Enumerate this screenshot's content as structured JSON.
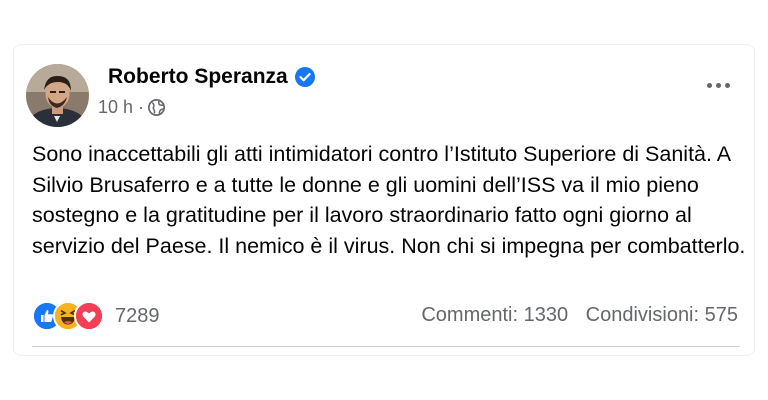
{
  "post": {
    "author": "Roberto Speranza",
    "verified": true,
    "time": "10 h",
    "separator": "·",
    "audience_icon": "globe-icon",
    "more_icon": "ellipsis-icon",
    "text": "Sono inaccettabili gli atti intimidatori contro l’Istituto Superiore di Sanità. A Silvio Brusaferro e a tutte le donne e gli uomini dell’ISS va il mio pieno sostegno e la gratitudine per il lavoro straordinario fatto ogni giorno al servizio del Paese. Il nemico è il virus. Non chi si impegna per combatterlo."
  },
  "reactions": {
    "icons": [
      "like-icon",
      "haha-icon",
      "love-icon"
    ],
    "count": "7289"
  },
  "stats": {
    "comments": "Commenti: 1330",
    "shares": "Condivisioni: 575"
  },
  "colors": {
    "like": "#1877f2",
    "love": "#f33e58",
    "haha": "#f7b125",
    "verified": "#1877f2",
    "secondary_text": "#65676b"
  }
}
